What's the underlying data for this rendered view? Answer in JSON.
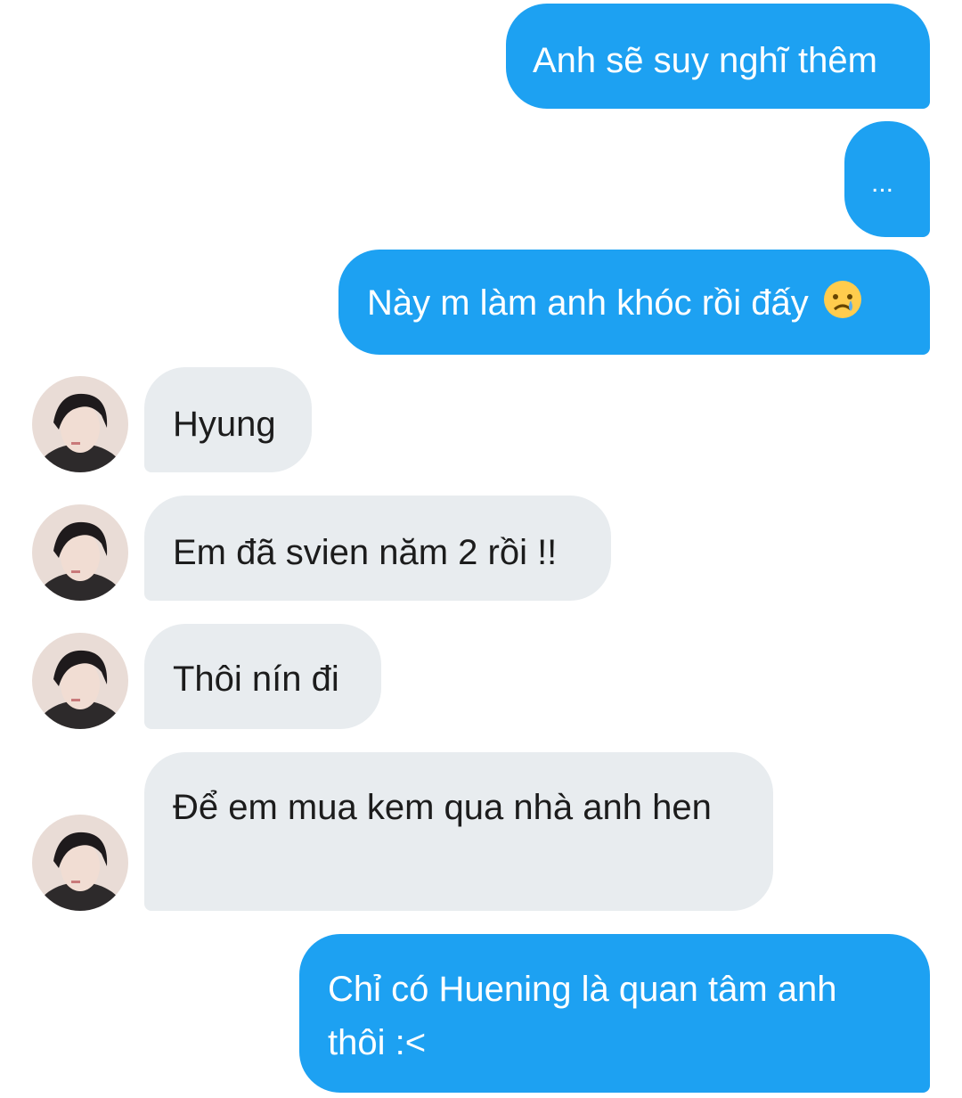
{
  "messages": [
    {
      "side": "outgoing",
      "text": "Anh sẽ suy nghĩ thêm"
    },
    {
      "side": "outgoing",
      "text": "..."
    },
    {
      "side": "outgoing",
      "text": "Này m làm anh khóc rồi đấy",
      "emoji": "crying-face-icon"
    },
    {
      "side": "incoming",
      "text": "Hyung",
      "avatar": "contact-avatar"
    },
    {
      "side": "incoming",
      "text": "Em đã svien năm 2 rồi !!",
      "avatar": "contact-avatar"
    },
    {
      "side": "incoming",
      "text": "Thôi nín đi",
      "avatar": "contact-avatar"
    },
    {
      "side": "incoming",
      "text": "Để em mua kem qua nhà anh hen",
      "avatar": "contact-avatar"
    },
    {
      "side": "outgoing",
      "text": "Chỉ có Huening là quan tâm anh thôi :<"
    }
  ],
  "colors": {
    "outgoing_bubble": "#1da1f2",
    "incoming_bubble": "#e8ecef",
    "outgoing_text": "#ffffff",
    "incoming_text": "#1c1c1c"
  }
}
